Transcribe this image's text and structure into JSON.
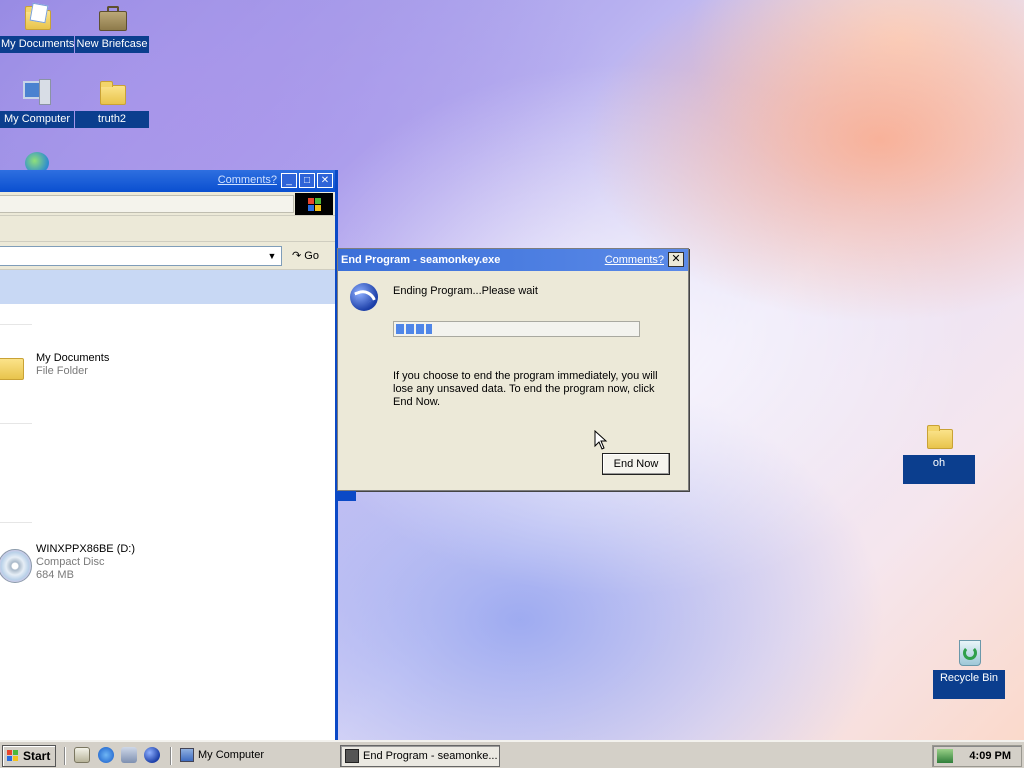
{
  "desktop": {
    "icons": [
      {
        "label": "My Documents",
        "icon": "my-documents-icon"
      },
      {
        "label": "New Briefcase",
        "icon": "briefcase-icon"
      },
      {
        "label": "My Computer",
        "icon": "my-computer-icon"
      },
      {
        "label": "truth2",
        "icon": "folder-icon"
      },
      {
        "label": "oh",
        "icon": "folder-icon"
      },
      {
        "label": "Recycle Bin",
        "icon": "recycle-bin-icon"
      }
    ]
  },
  "explorer": {
    "comments_link": "Comments?",
    "go_label": "Go",
    "items": [
      {
        "name": "My Documents",
        "type": "File Folder",
        "size": ""
      },
      {
        "name": "WINXPPX86BE (D:)",
        "type": "Compact Disc",
        "size": "684 MB"
      }
    ]
  },
  "dialog": {
    "title": "End Program - seamonkey.exe",
    "comments_link": "Comments?",
    "close_label": "✕",
    "message": "Ending Program...Please wait",
    "progress_fraction": 0.15,
    "info": "If you choose to end the program immediately, you will lose any unsaved data. To end the program now, click End Now.",
    "end_now_label": "End Now"
  },
  "taskbar": {
    "start_label": "Start",
    "tasks": [
      {
        "label": "My Computer",
        "active": false
      },
      {
        "label": "End Program - seamonke...",
        "active": true
      }
    ],
    "clock": "4:09 PM"
  }
}
